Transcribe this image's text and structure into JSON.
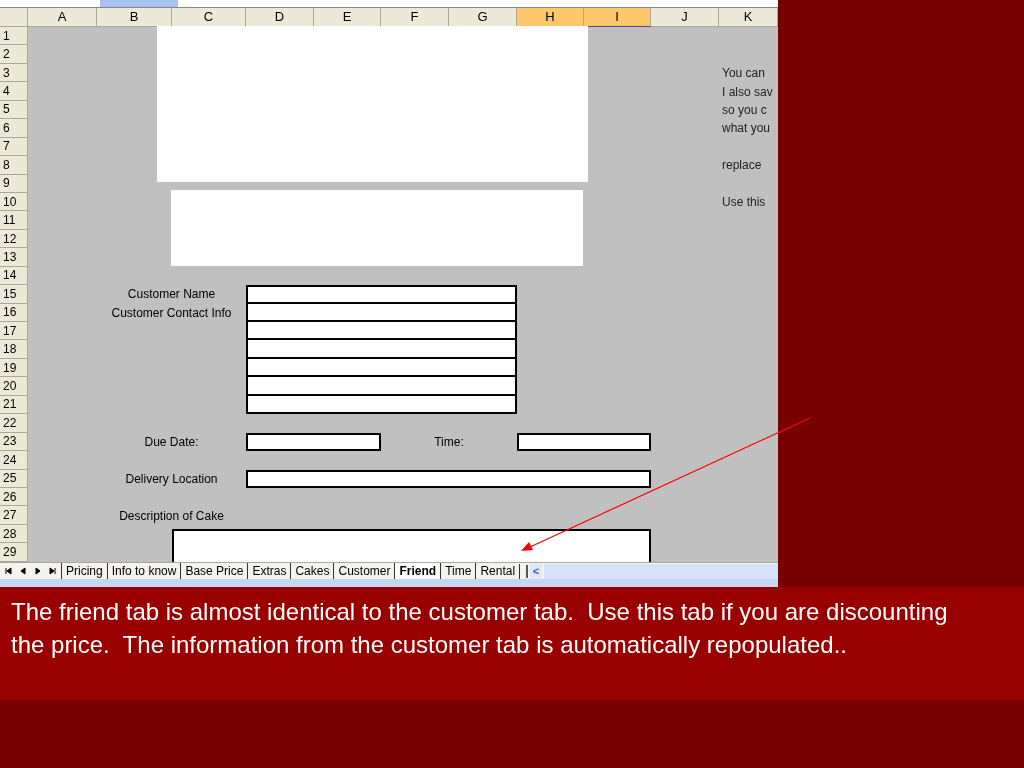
{
  "spreadsheet": {
    "columns": [
      {
        "label": "A",
        "selected": false
      },
      {
        "label": "B",
        "selected": false
      },
      {
        "label": "C",
        "selected": false
      },
      {
        "label": "D",
        "selected": false
      },
      {
        "label": "E",
        "selected": false
      },
      {
        "label": "F",
        "selected": false
      },
      {
        "label": "G",
        "selected": false
      },
      {
        "label": "H",
        "selected": true
      },
      {
        "label": "I",
        "selected": true
      },
      {
        "label": "J",
        "selected": false
      },
      {
        "label": "K",
        "selected": false
      }
    ],
    "rows": [
      "1",
      "2",
      "3",
      "4",
      "5",
      "6",
      "7",
      "8",
      "9",
      "10",
      "11",
      "12",
      "13",
      "14",
      "15",
      "16",
      "17",
      "18",
      "19",
      "20",
      "21",
      "22",
      "23",
      "24",
      "25",
      "26",
      "27",
      "28",
      "29"
    ],
    "form_labels": [
      "Customer Name",
      "Customer Contact Info",
      "Due Date:",
      "Time:",
      "Delivery Location",
      "Description of Cake"
    ],
    "notes": [
      "You can",
      "I also sav",
      "so you c",
      "what you",
      "replace",
      "Use this"
    ],
    "sheet_tabs": [
      {
        "label": "Pricing",
        "selected": false
      },
      {
        "label": "Info to know",
        "selected": false
      },
      {
        "label": "Base Price",
        "selected": false
      },
      {
        "label": "Extras",
        "selected": false
      },
      {
        "label": "Cakes",
        "selected": false
      },
      {
        "label": "Customer",
        "selected": false
      },
      {
        "label": "Friend",
        "selected": true
      },
      {
        "label": "Time",
        "selected": false
      },
      {
        "label": "Rental",
        "selected": false
      }
    ],
    "scroll_left": "<"
  },
  "caption": "The friend tab is almost identical to the customer tab.  Use this tab if you are discounting the price.  The information from the customer tab is automatically repopulated.."
}
